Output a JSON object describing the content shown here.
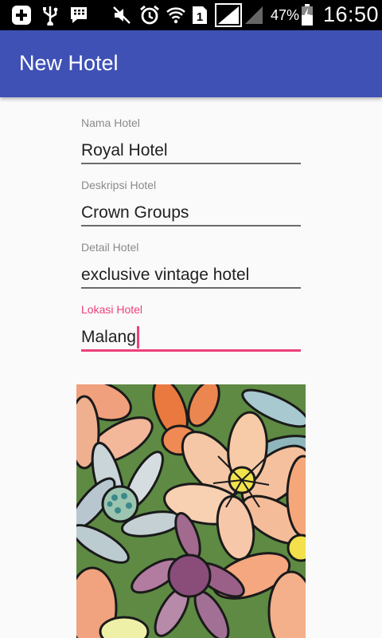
{
  "status_bar": {
    "battery_percent": "47%",
    "time": "16:50",
    "sim_slot": "1",
    "icons": [
      "add-app-icon",
      "usb-icon",
      "bbm-icon",
      "mute-icon",
      "alarm-icon",
      "wifi-icon",
      "sim-icon",
      "signal-icon",
      "signal-empty-icon",
      "battery-icon"
    ]
  },
  "app_bar": {
    "title": "New Hotel"
  },
  "form": {
    "nama_hotel": {
      "label": "Nama Hotel",
      "value": "Royal Hotel"
    },
    "deskripsi_hotel": {
      "label": "Deskripsi Hotel",
      "value": "Crown Groups"
    },
    "detail_hotel": {
      "label": "Detail Hotel",
      "value": "exclusive vintage hotel"
    },
    "lokasi_hotel": {
      "label": "Lokasi Hotel",
      "value": "Malang"
    }
  },
  "colors": {
    "primary": "#3f51b5",
    "accent": "#ec407a",
    "status_bar": "#000000",
    "background": "#fafafa"
  },
  "image": {
    "description_icon": "floral-illustration-image"
  }
}
